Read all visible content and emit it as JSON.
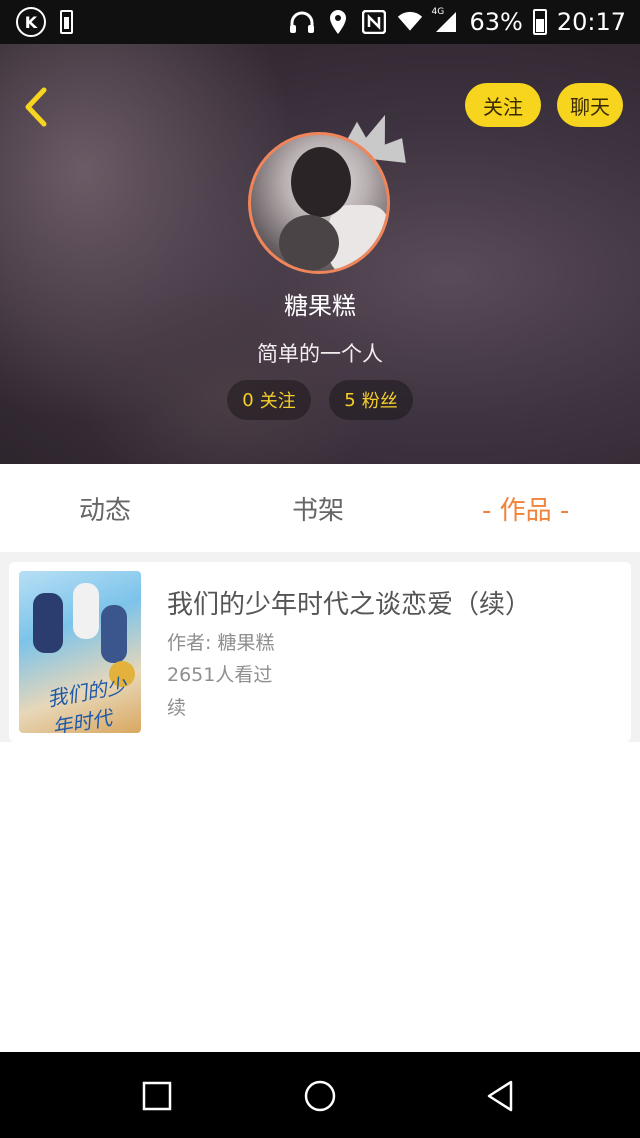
{
  "status_bar": {
    "left_icon_letter": "K",
    "battery_percent": "63%",
    "time": "20:17",
    "network": "4G"
  },
  "header": {
    "follow_label": "关注",
    "chat_label": "聊天"
  },
  "profile": {
    "name": "糖果糕",
    "bio": "简单的一个人",
    "following_count": "0",
    "following_label": "关注",
    "fans_count": "5",
    "fans_label": "粉丝"
  },
  "tabs": [
    {
      "label": "动态"
    },
    {
      "label": "书架"
    },
    {
      "label": "- 作品 -",
      "active": true
    }
  ],
  "works": [
    {
      "title": "我们的少年时代之谈恋爱（续）",
      "author": "作者: 糖果糕",
      "views": "2651人看过",
      "status": "续",
      "cover_text": "我们的少年时代"
    }
  ],
  "colors": {
    "accent_yellow": "#f7d51f",
    "active_tab": "#f0823a",
    "avatar_ring": "#f0855a"
  }
}
